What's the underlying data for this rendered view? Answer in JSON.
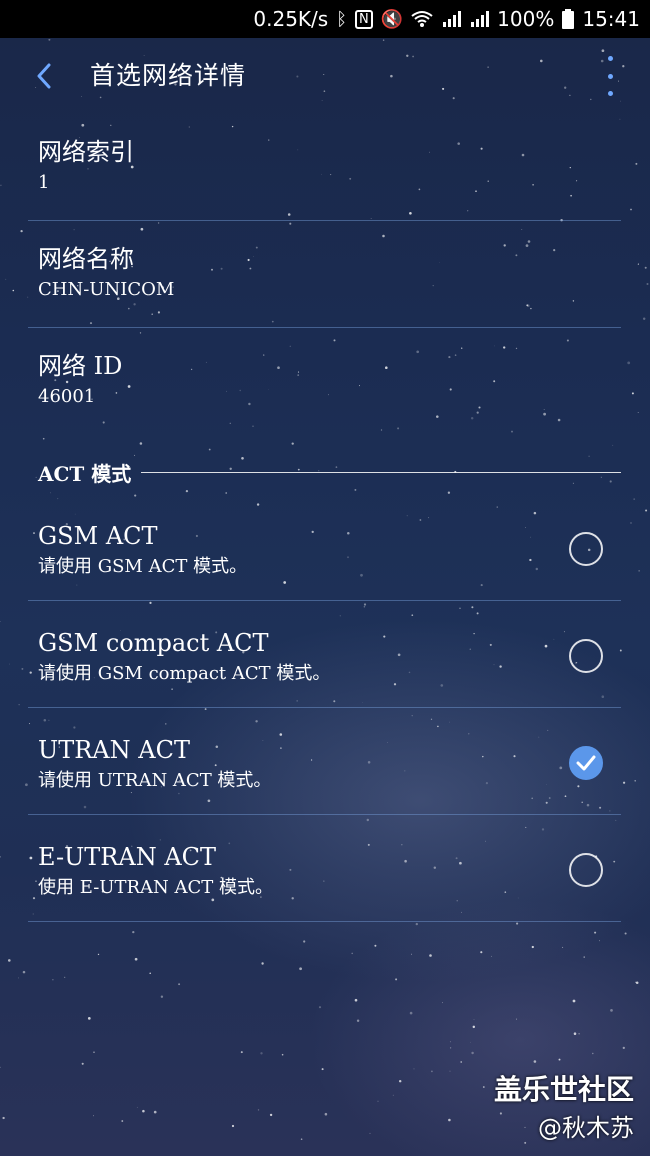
{
  "status_bar": {
    "speed": "0.25K/s",
    "battery": "100%",
    "time": "15:41",
    "icons": [
      "bluetooth-icon",
      "nfc-icon",
      "mute-icon",
      "wifi-icon",
      "signal-4g-icon",
      "signal-2g-icon",
      "battery-icon"
    ]
  },
  "header": {
    "title": "首选网络详情"
  },
  "info": [
    {
      "label": "网络索引",
      "value": "1"
    },
    {
      "label": "网络名称",
      "value": "CHN-UNICOM"
    },
    {
      "label": "网络 ID",
      "value": "46001"
    }
  ],
  "section_title": "ACT 模式",
  "options": [
    {
      "title": "GSM ACT",
      "desc": "请使用 GSM ACT 模式。",
      "checked": false
    },
    {
      "title": "GSM compact ACT",
      "desc": "请使用 GSM compact ACT 模式。",
      "checked": false
    },
    {
      "title": "UTRAN ACT",
      "desc": "请使用 UTRAN ACT 模式。",
      "checked": true
    },
    {
      "title": "E-UTRAN ACT",
      "desc": "使用 E-UTRAN ACT 模式。",
      "checked": false
    }
  ],
  "watermark": {
    "brand": "盖乐世社区",
    "author": "@秋木苏"
  },
  "colors": {
    "accent": "#5b97ea"
  }
}
